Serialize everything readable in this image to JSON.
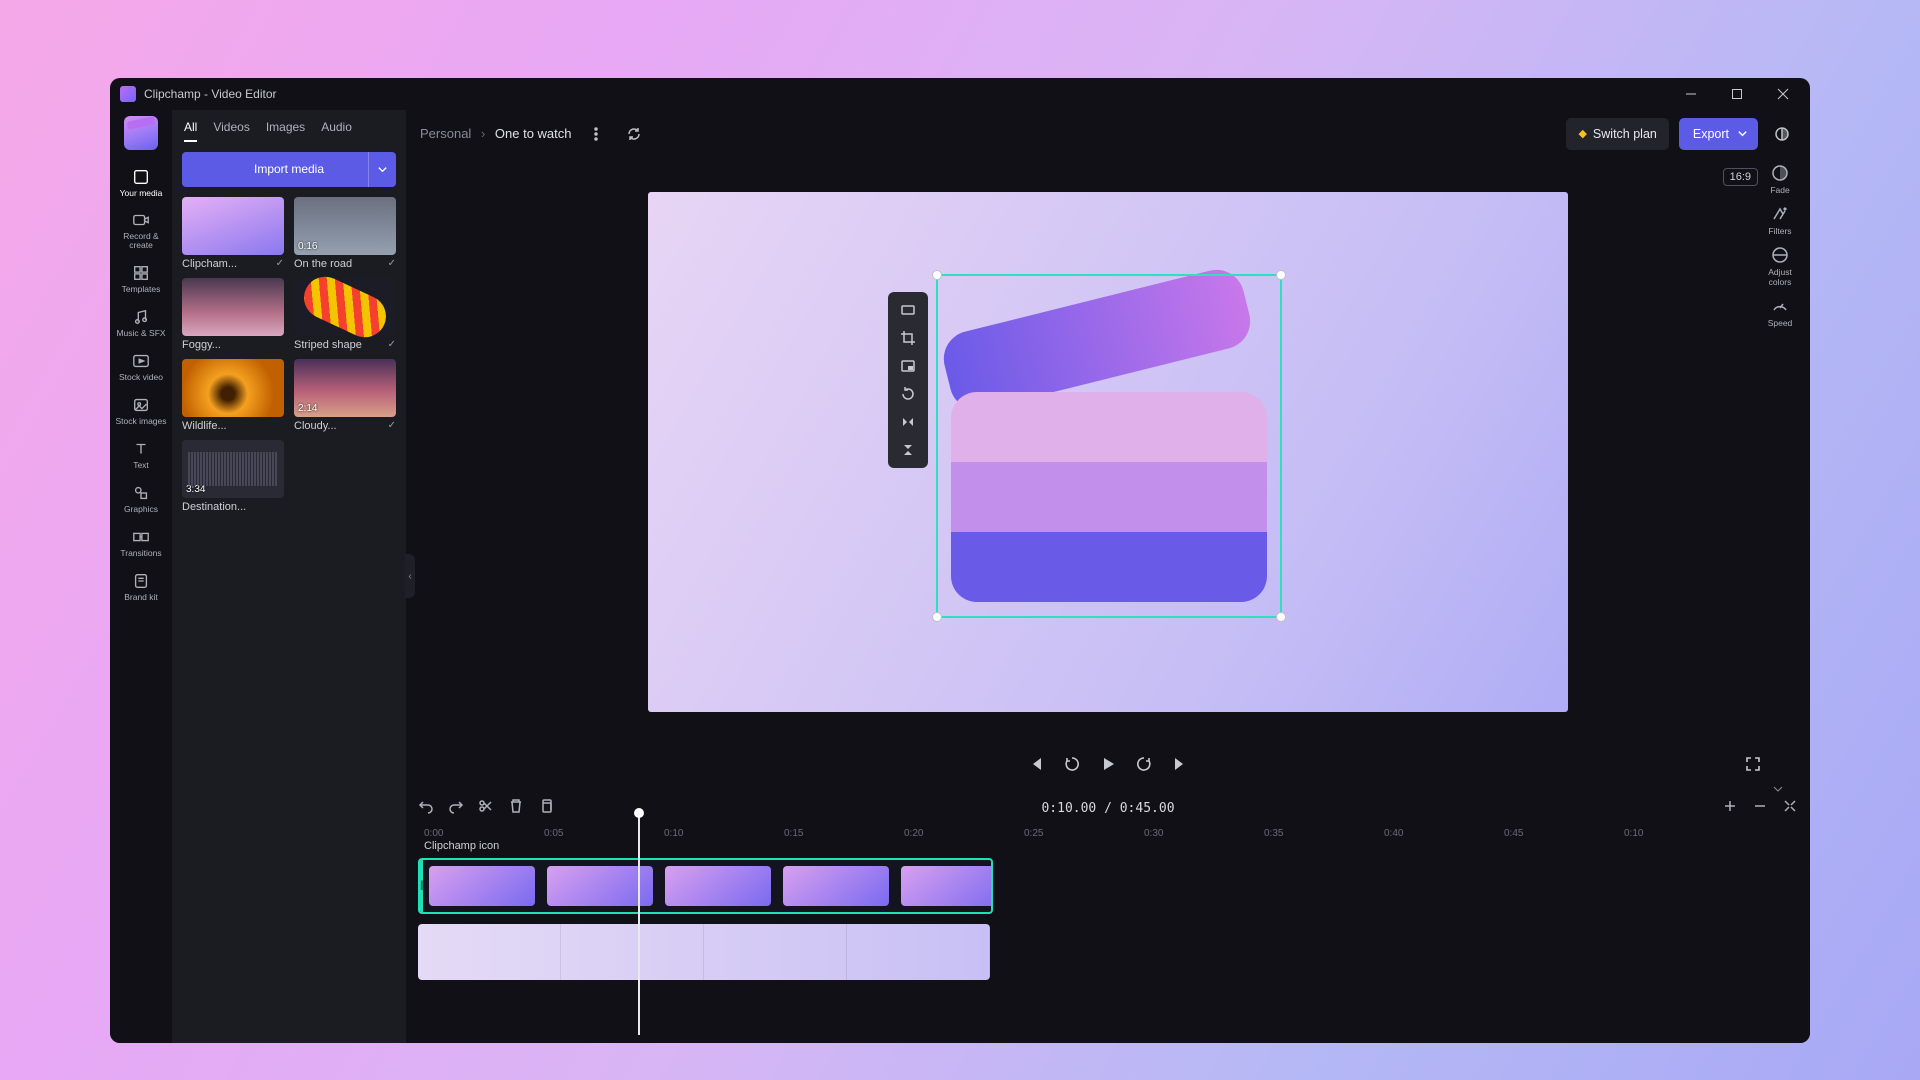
{
  "window": {
    "title": "Clipchamp - Video Editor"
  },
  "breadcrumb": {
    "workspace": "Personal",
    "project": "One to watch"
  },
  "topbar": {
    "switch_plan": "Switch plan",
    "export": "Export"
  },
  "aspect_ratio": "16:9",
  "rail": [
    {
      "key": "your-media",
      "label": "Your media"
    },
    {
      "key": "record",
      "label": "Record & create"
    },
    {
      "key": "templates",
      "label": "Templates"
    },
    {
      "key": "music",
      "label": "Music & SFX"
    },
    {
      "key": "stock-video",
      "label": "Stock video"
    },
    {
      "key": "stock-images",
      "label": "Stock images"
    },
    {
      "key": "text",
      "label": "Text"
    },
    {
      "key": "graphics",
      "label": "Graphics"
    },
    {
      "key": "transitions",
      "label": "Transitions"
    },
    {
      "key": "brand-kit",
      "label": "Brand kit"
    }
  ],
  "media_tabs": {
    "all": "All",
    "videos": "Videos",
    "images": "Images",
    "audio": "Audio"
  },
  "import_label": "Import media",
  "media": [
    {
      "name": "Clipcham...",
      "duration": "",
      "thumb": "clipchamp"
    },
    {
      "name": "On the road",
      "duration": "0:16",
      "thumb": "road"
    },
    {
      "name": "Foggy...",
      "duration": "",
      "thumb": "foggy"
    },
    {
      "name": "Striped shape",
      "duration": "",
      "thumb": "striped"
    },
    {
      "name": "Wildlife...",
      "duration": "",
      "thumb": "wildlife"
    },
    {
      "name": "Cloudy...",
      "duration": "2:14",
      "thumb": "cloudy"
    },
    {
      "name": "Destination...",
      "duration": "3:34",
      "thumb": "audio"
    }
  ],
  "props": [
    {
      "key": "fade",
      "label": "Fade"
    },
    {
      "key": "filters",
      "label": "Filters"
    },
    {
      "key": "adjust",
      "label": "Adjust colors"
    },
    {
      "key": "speed",
      "label": "Speed"
    }
  ],
  "float_tools": [
    "fit",
    "crop",
    "pip",
    "rotate",
    "flip-h",
    "flip-v"
  ],
  "timecode": "0:10.00 / 0:45.00",
  "ruler": [
    "0:00",
    "0:05",
    "0:10",
    "0:15",
    "0:20",
    "0:25",
    "0:30",
    "0:35",
    "0:40",
    "0:45",
    "0:10"
  ],
  "clip_name": "Clipchamp icon"
}
